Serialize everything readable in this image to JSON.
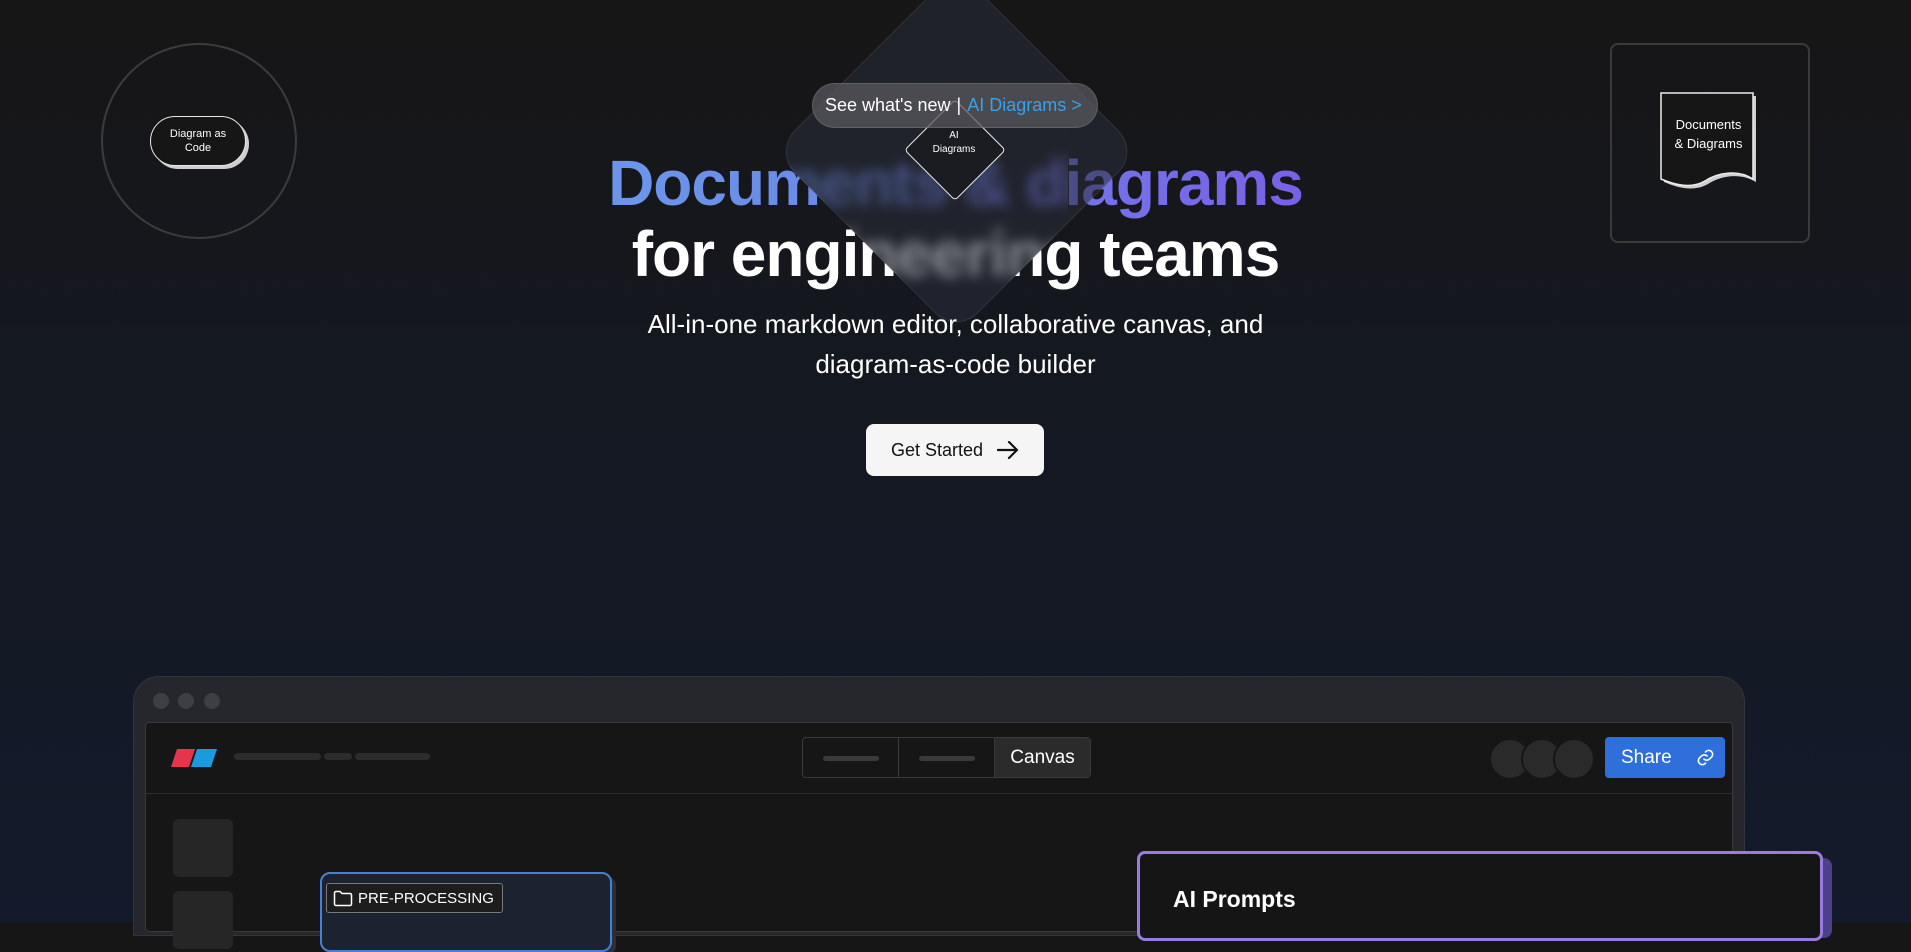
{
  "decorations": {
    "circle_label": "Diagram as Code",
    "square_label_line1": "Documents",
    "square_label_line2": "& Diagrams",
    "diamond_label_line1": "AI",
    "diamond_label_line2": "Diagrams"
  },
  "announcement": {
    "text": "See what's new",
    "separator": "|",
    "link": "AI Diagrams >"
  },
  "hero": {
    "title_line1": "Documents & diagrams",
    "title_line2": "for engineering teams",
    "subtitle_line1": "All-in-one markdown editor, collaborative canvas, and",
    "subtitle_line2": "diagram-as-code builder",
    "cta_label": "Get Started"
  },
  "mockup": {
    "view_tab_active": "Canvas",
    "share_label": "Share",
    "node_label": "PRE-PROCESSING",
    "panel_title": "AI Prompts"
  },
  "colors": {
    "background": "#161616",
    "accent_blue": "#2e6fdc",
    "link_blue": "#3aa0e8",
    "gradient_start": "#76b3f2",
    "gradient_end": "#9a3cea",
    "panel_border": "#9a7be0",
    "logo_red": "#e8344a",
    "logo_blue": "#1a9be0"
  }
}
